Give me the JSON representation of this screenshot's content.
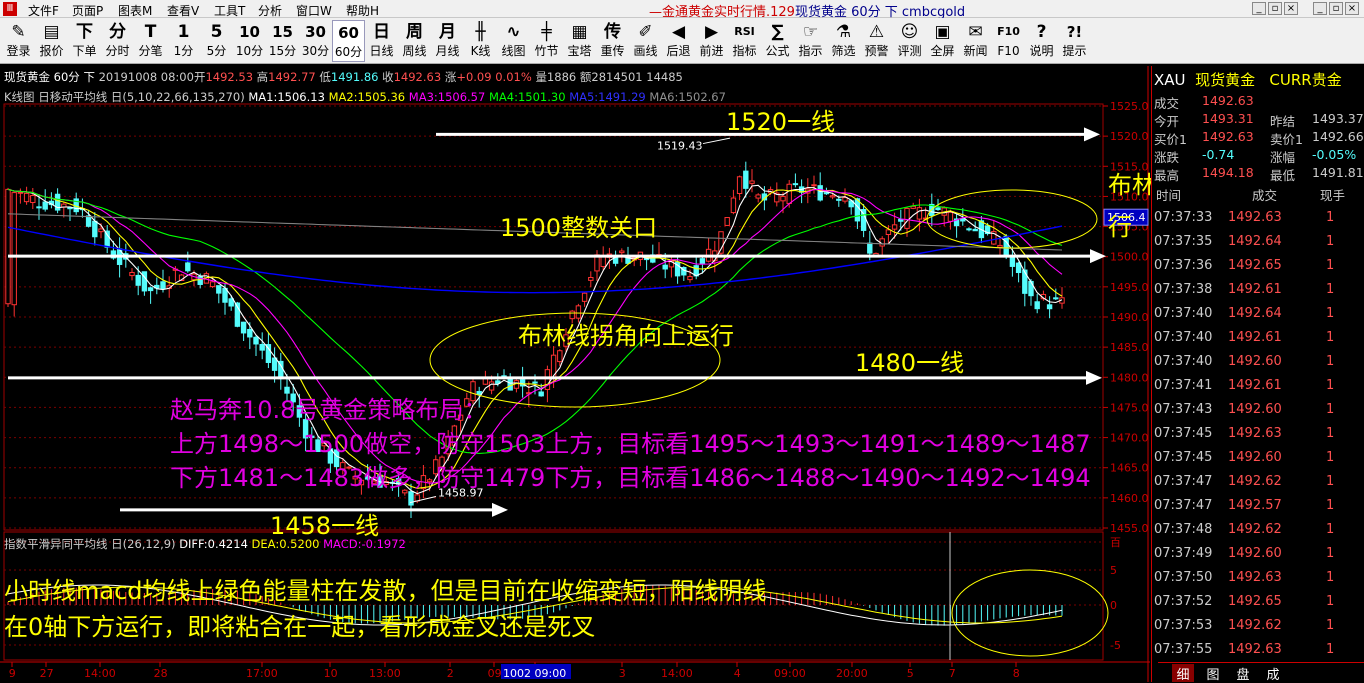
{
  "menubar": {
    "items": [
      "文件F",
      "页面P",
      "图表M",
      "查看V",
      "工具T",
      "分析",
      "窗口W",
      "帮助H"
    ],
    "title_a": "—金通黄金实时行情.129",
    "title_b": "现货黄金 60分 下 cmbcgold"
  },
  "toolbar": {
    "buttons": [
      {
        "icon": "✎",
        "label": "登录"
      },
      {
        "icon": "▤",
        "label": "报价"
      },
      {
        "icon": "下",
        "label": "下单"
      },
      {
        "icon": "分",
        "label": "分时"
      },
      {
        "icon": "T",
        "label": "分笔"
      },
      {
        "icon": "1",
        "label": "1分"
      },
      {
        "icon": "5",
        "label": "5分"
      },
      {
        "icon": "10",
        "label": "10分"
      },
      {
        "icon": "15",
        "label": "15分"
      },
      {
        "icon": "30",
        "label": "30分"
      },
      {
        "icon": "60",
        "label": "60分"
      },
      {
        "icon": "日",
        "label": "日线"
      },
      {
        "icon": "周",
        "label": "周线"
      },
      {
        "icon": "月",
        "label": "月线"
      },
      {
        "icon": "╫",
        "label": "K线"
      },
      {
        "icon": "∿",
        "label": "线图"
      },
      {
        "icon": "╪",
        "label": "竹节"
      },
      {
        "icon": "▦",
        "label": "宝塔"
      },
      {
        "icon": "传",
        "label": "重传"
      },
      {
        "icon": "✐",
        "label": "画线"
      },
      {
        "icon": "◀",
        "label": "后退"
      },
      {
        "icon": "▶",
        "label": "前进"
      },
      {
        "icon": "RSI",
        "label": "指标"
      },
      {
        "icon": "∑",
        "label": "公式"
      },
      {
        "icon": "☞",
        "label": "指示"
      },
      {
        "icon": "⚗",
        "label": "筛选"
      },
      {
        "icon": "⚠",
        "label": "预警"
      },
      {
        "icon": "☺",
        "label": "评测"
      },
      {
        "icon": "▣",
        "label": "全屏"
      },
      {
        "icon": "✉",
        "label": "新闻"
      },
      {
        "icon": "F10",
        "label": "F10"
      },
      {
        "icon": "?",
        "label": "说明"
      },
      {
        "icon": "?!",
        "label": "提示"
      }
    ]
  },
  "info": {
    "line1": {
      "name": "现货黄金",
      "period": "60分",
      "dir": "下",
      "date": "20191008 08:00",
      "open_l": "开",
      "open": "1492.53",
      "high_l": "高",
      "high": "1492.77",
      "low_l": "低",
      "low": "1491.86",
      "close_l": "收",
      "close": "1492.63",
      "chg_l": "涨",
      "chg": "+0.09",
      "pct": "0.01%",
      "vol": "量1886",
      "amt": "额2814501",
      "oi": "14485"
    },
    "line2": {
      "label": "K线图 日移动平均线 日(5,10,22,66,135,270)",
      "ma1": "MA1:1506.13",
      "ma2": "MA2:1505.36",
      "ma3": "MA3:1506.57",
      "ma4": "MA4:1501.30",
      "ma5": "MA5:1491.29",
      "ma6": "MA6:1502.67"
    },
    "macd": {
      "label": "指数平滑异同平均线 日(26,12,9)",
      "diff": "DIFF:0.4214",
      "dea": "DEA:0.5200",
      "macd": "MACD:-0.1972"
    }
  },
  "price_axis": [
    "1525.0",
    "1520.0",
    "1515.0",
    "1510.0",
    "1505.0",
    "1500.0",
    "1495.0",
    "1490.0",
    "1485.0",
    "1480.0",
    "1475.0",
    "1470.0",
    "1465.0",
    "1460.0",
    "1455.0"
  ],
  "current_price_tag": "1506.4",
  "macd_axis": [
    "百",
    "5",
    "0",
    "-5"
  ],
  "time_axis": [
    "9",
    "27",
    "14:00",
    "28",
    "17:00",
    "10",
    "13:00",
    "2",
    "09",
    "1002 09:00",
    "3",
    "14:00",
    "4",
    "09:00",
    "20:00",
    "5",
    "7",
    "8"
  ],
  "chart_labels": {
    "high_mark": "1519.43",
    "low_mark": "1458.97"
  },
  "annotations": {
    "l1520": "1520一线",
    "l1500": "1500整数关口",
    "l1480": "1480一线",
    "l1458": "1458一线",
    "boll_up": "布林线拐角向上运行",
    "boll_flat_1": "布林线拐角平行运",
    "boll_flat_2": "行",
    "strategy_title": "赵马奔10.8号黄金策略布局：",
    "strategy_1": "上方1498～1500做空，防守1503上方，目标看1495～1493～1491～1489～1487",
    "strategy_2": "下方1481～1483做多，防守1479下方，目标看1486～1488～1490～1492～1494",
    "macd_1": "小时线macd均线上绿色能量柱在发散，但是目前在收缩变短，阳线阴线",
    "macd_2": "在0轴下方运行，即将粘合在一起，看形成金叉还是死叉"
  },
  "quote_panel": {
    "symbol": "XAU",
    "name": "现货黄金",
    "market": "CURR贵金",
    "rows": [
      {
        "l1": "成交",
        "v1": "1492.63",
        "l2": "",
        "v2": ""
      },
      {
        "l1": "今开",
        "v1": "1493.31",
        "l2": "昨结",
        "v2": "1493.37"
      },
      {
        "l1": "买价1",
        "v1": "1492.63",
        "l2": "卖价1",
        "v2": "1492.66"
      },
      {
        "l1": "涨跌",
        "v1": "-0.74",
        "l2": "涨幅",
        "v2": "-0.05%"
      },
      {
        "l1": "最高",
        "v1": "1494.18",
        "l2": "最低",
        "v2": "1491.81"
      }
    ],
    "tick_header": {
      "time": "时间",
      "price": "成交",
      "vol": "现手"
    },
    "ticks": [
      {
        "t": "07:37:33",
        "p": "1492.63",
        "v": "1"
      },
      {
        "t": "07:37:35",
        "p": "1492.64",
        "v": "1"
      },
      {
        "t": "07:37:36",
        "p": "1492.65",
        "v": "1"
      },
      {
        "t": "07:37:38",
        "p": "1492.61",
        "v": "1"
      },
      {
        "t": "07:37:40",
        "p": "1492.64",
        "v": "1"
      },
      {
        "t": "07:37:40",
        "p": "1492.61",
        "v": "1"
      },
      {
        "t": "07:37:40",
        "p": "1492.60",
        "v": "1"
      },
      {
        "t": "07:37:41",
        "p": "1492.61",
        "v": "1"
      },
      {
        "t": "07:37:43",
        "p": "1492.60",
        "v": "1"
      },
      {
        "t": "07:37:45",
        "p": "1492.63",
        "v": "1"
      },
      {
        "t": "07:37:45",
        "p": "1492.60",
        "v": "1"
      },
      {
        "t": "07:37:47",
        "p": "1492.62",
        "v": "1"
      },
      {
        "t": "07:37:47",
        "p": "1492.57",
        "v": "1"
      },
      {
        "t": "07:37:48",
        "p": "1492.62",
        "v": "1"
      },
      {
        "t": "07:37:49",
        "p": "1492.60",
        "v": "1"
      },
      {
        "t": "07:37:50",
        "p": "1492.63",
        "v": "1"
      },
      {
        "t": "07:37:52",
        "p": "1492.65",
        "v": "1"
      },
      {
        "t": "07:37:53",
        "p": "1492.62",
        "v": "1"
      },
      {
        "t": "07:37:55",
        "p": "1492.63",
        "v": "1"
      }
    ]
  },
  "bottom_tabs": [
    "细",
    "图",
    "盘",
    "成"
  ],
  "colors": {
    "up": "#ff3232",
    "down": "#54fcfc",
    "ma1": "#ffffff",
    "ma2": "#ffff00",
    "ma3": "#ff00ff",
    "ma4": "#00ff00",
    "ma5": "#0000ff",
    "ma6": "#808080",
    "purple_text": "#e000e0",
    "yellow_text": "#ffff00"
  }
}
